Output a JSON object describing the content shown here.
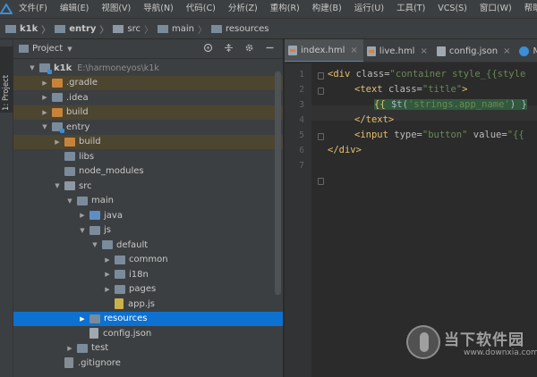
{
  "menu": [
    "文件(F)",
    "编辑(E)",
    "视图(V)",
    "导航(N)",
    "代码(C)",
    "分析(Z)",
    "重构(R)",
    "构建(B)",
    "运行(U)",
    "工具(T)",
    "VCS(S)",
    "窗口(W)",
    "帮助(H)"
  ],
  "breadcrumb": [
    "k1k",
    "entry",
    "src",
    "main",
    "resources"
  ],
  "side_tab": "1: Project",
  "panel": {
    "title": "Project",
    "tools": [
      "target-icon",
      "collapse-icon",
      "gear-icon",
      "minimize-icon"
    ]
  },
  "tree": [
    {
      "label": "k1k",
      "path": "E:\\harmoneyos\\k1k",
      "depth": 0,
      "arrow": "down",
      "icon": "module"
    },
    {
      "label": ".gradle",
      "depth": 1,
      "arrow": "right",
      "icon": "folder-orange",
      "hl": true
    },
    {
      "label": ".idea",
      "depth": 1,
      "arrow": "right",
      "icon": "folder"
    },
    {
      "label": "build",
      "depth": 1,
      "arrow": "right",
      "icon": "folder-orange",
      "hl": true
    },
    {
      "label": "entry",
      "depth": 1,
      "arrow": "down",
      "icon": "module"
    },
    {
      "label": "build",
      "depth": 2,
      "arrow": "right",
      "icon": "folder-orange",
      "hl": true
    },
    {
      "label": "libs",
      "depth": 2,
      "arrow": "",
      "icon": "folder"
    },
    {
      "label": "node_modules",
      "depth": 2,
      "arrow": "",
      "icon": "folder"
    },
    {
      "label": "src",
      "depth": 2,
      "arrow": "down",
      "icon": "folder-src"
    },
    {
      "label": "main",
      "depth": 3,
      "arrow": "down",
      "icon": "folder"
    },
    {
      "label": "java",
      "depth": 4,
      "arrow": "right",
      "icon": "folder-blue"
    },
    {
      "label": "js",
      "depth": 4,
      "arrow": "down",
      "icon": "folder"
    },
    {
      "label": "default",
      "depth": 5,
      "arrow": "down",
      "icon": "folder"
    },
    {
      "label": "common",
      "depth": 6,
      "arrow": "right",
      "icon": "folder"
    },
    {
      "label": "i18n",
      "depth": 6,
      "arrow": "right",
      "icon": "folder"
    },
    {
      "label": "pages",
      "depth": 6,
      "arrow": "right",
      "icon": "folder"
    },
    {
      "label": "app.js",
      "depth": 6,
      "arrow": "",
      "icon": "file-js"
    },
    {
      "label": "resources",
      "depth": 4,
      "arrow": "right",
      "icon": "folder",
      "sel": true
    },
    {
      "label": "config.json",
      "depth": 4,
      "arrow": "",
      "icon": "file-json"
    },
    {
      "label": "test",
      "depth": 3,
      "arrow": "right",
      "icon": "folder"
    },
    {
      "label": ".gitignore",
      "depth": 2,
      "arrow": "",
      "icon": "file-git"
    }
  ],
  "tabs": [
    {
      "label": "index.hml",
      "icon": "html",
      "active": true
    },
    {
      "label": "live.hml",
      "icon": "html"
    },
    {
      "label": "config.json",
      "icon": "json"
    },
    {
      "label": "Mai",
      "icon": "c"
    }
  ],
  "line_numbers": [
    "1",
    "2",
    "3",
    "4",
    "5",
    "6",
    "7"
  ],
  "code": {
    "l1_open": "<div ",
    "l1_attr": "class=",
    "l1_str": "\"container style_{{style",
    "l2_open": "<text ",
    "l2_attr": "class=",
    "l2_str": "\"title\"",
    "l2_close": ">",
    "l3_a": "{{ ",
    "l3_b": "$t(",
    "l3_c": "'strings.app_name'",
    "l3_d": ") }",
    "l4": "</text>",
    "l5_open": "<input ",
    "l5_attr1": "type=",
    "l5_str1": "\"button\"",
    "l5_attr2": " value=",
    "l5_str2": "\"{{",
    "l6": "</div>"
  },
  "watermark": {
    "name": "当下软件园",
    "url": "www.downxia.com"
  },
  "colors": {
    "selection": "#0d71d1",
    "ignored_highlight": "#4c4530",
    "tag": "#e8bf6a",
    "string": "#6a8759"
  }
}
